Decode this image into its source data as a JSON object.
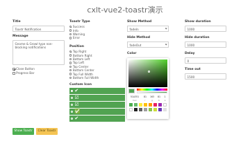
{
  "app": {
    "title": "cxlt-vue2-toastr演示"
  },
  "title_field": {
    "label": "Title",
    "value": "Toastr Notification"
  },
  "message_field": {
    "label": "Message",
    "value": "Gnome & Growl type non-blocking notifications"
  },
  "options": {
    "close_button": "Close Button",
    "progress_bar": "Progress Bar"
  },
  "toast_type": {
    "label": "Toastr Type",
    "options": [
      "Success",
      "Info",
      "Warning",
      "Error"
    ],
    "selected": "Success"
  },
  "position": {
    "label": "Position",
    "options": [
      "Top Right",
      "Bottom Right",
      "Bottom Left",
      "Top Left",
      "Top Center",
      "Bottom Center",
      "Top Full Width",
      "Bottom Full Width"
    ],
    "selected": "Top Right"
  },
  "custom_icon": {
    "label": "Custom Icon",
    "icon_names": [
      "check-circle-icon",
      "check-square-icon",
      "check-square-icon",
      "check-square-outline-icon",
      "check-mark-icon"
    ],
    "selected_index": 0
  },
  "show_method": {
    "label": "Show Method",
    "value": "fadeIn"
  },
  "hide_method": {
    "label": "Hide Method",
    "value": "fadeOut"
  },
  "color": {
    "label": "Color",
    "value": "#51a351"
  },
  "color_picker": {
    "hex": "51A351",
    "r": "81",
    "g": "163",
    "b": "81",
    "a": "1",
    "hex_label": "hex",
    "r_label": "r",
    "g_label": "g",
    "b_label": "b",
    "a_label": "a",
    "swatches": [
      "#4caf50",
      "#66bb6a",
      "#ffeb3b",
      "#ffc107",
      "#ff9800",
      "#e91e63",
      "#9c27b0",
      "#ffffff",
      "#ffffff",
      "#212121",
      "#616161",
      "#9e9e9e",
      "#8bc34a",
      "#cddc39",
      "#673ab7",
      "#e0e0e0"
    ]
  },
  "show_duration": {
    "label": "Show duration",
    "value": "1000"
  },
  "hide_duration": {
    "label": "Hide duration",
    "value": "1000"
  },
  "delay": {
    "label": "Delay",
    "value": "0"
  },
  "timeout": {
    "label": "Time out",
    "value": "1500"
  },
  "buttons": {
    "show": "Show Toastr",
    "clear": "Clear Toastr",
    "show_color": "#4caf50",
    "clear_color": "#f5c453"
  }
}
